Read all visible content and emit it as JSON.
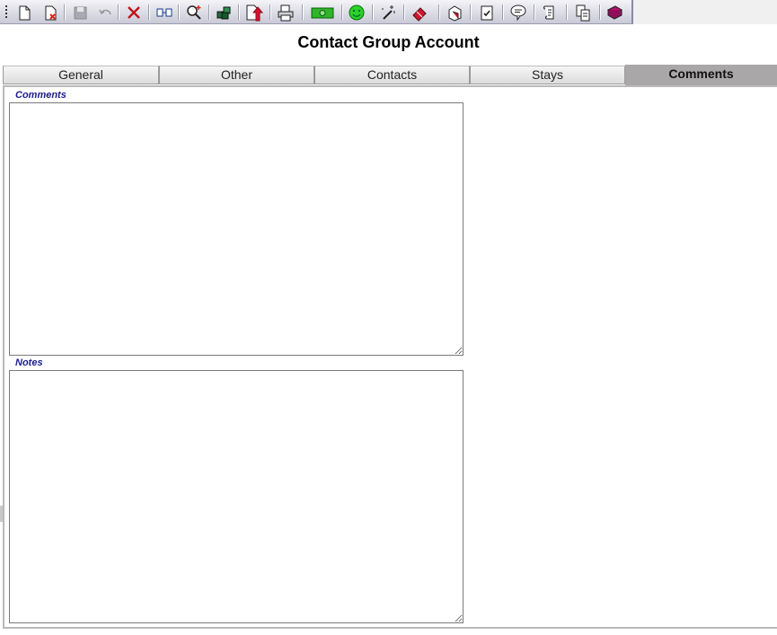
{
  "toolbar": {
    "buttons": [
      {
        "name": "new-icon"
      },
      {
        "name": "delete-document-icon"
      },
      {
        "name": "save-icon"
      },
      {
        "name": "undo-icon"
      },
      {
        "name": "cancel-icon"
      },
      {
        "name": "compare-icon"
      },
      {
        "name": "find-icon"
      },
      {
        "name": "network-icon"
      },
      {
        "name": "upload-icon"
      },
      {
        "name": "print-icon"
      },
      {
        "name": "money-icon"
      },
      {
        "name": "smiley-icon"
      },
      {
        "name": "magic-wand-icon"
      },
      {
        "name": "eraser-icon"
      },
      {
        "name": "box-icon"
      },
      {
        "name": "checklist-icon"
      },
      {
        "name": "comment-icon"
      },
      {
        "name": "scroll-icon"
      },
      {
        "name": "copy-icon"
      },
      {
        "name": "book-icon"
      }
    ]
  },
  "page": {
    "title": "Contact Group Account"
  },
  "tabs": [
    {
      "label": "General",
      "active": false
    },
    {
      "label": "Other",
      "active": false
    },
    {
      "label": "Contacts",
      "active": false
    },
    {
      "label": "Stays",
      "active": false
    },
    {
      "label": "Comments",
      "active": true
    }
  ],
  "form": {
    "comments_label": "Comments",
    "comments_value": "",
    "notes_label": "Notes",
    "notes_value": ""
  }
}
